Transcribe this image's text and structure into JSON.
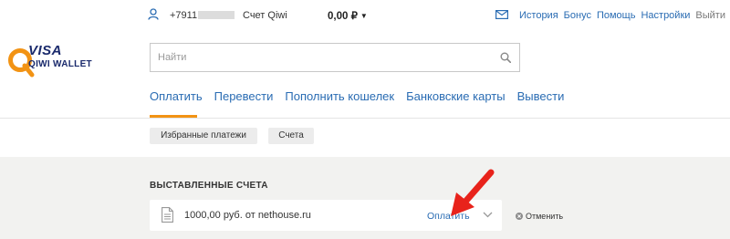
{
  "header": {
    "phone_prefix": "+7911",
    "account_label": "Счет Qiwi",
    "balance": "0,00 ₽",
    "balance_caret": "▼",
    "links": [
      "История",
      "Бонус",
      "Помощь",
      "Настройки"
    ],
    "logout": "Выйти"
  },
  "logo": {
    "visa": "VISA",
    "qiwi_wallet": "QIWI WALLET"
  },
  "search": {
    "placeholder": "Найти",
    "value": ""
  },
  "main_nav": {
    "items": [
      "Оплатить",
      "Перевести",
      "Пополнить кошелек",
      "Банковские карты",
      "Вывести"
    ],
    "active": "Оплатить"
  },
  "sub_tabs": [
    "Избранные платежи",
    "Счета"
  ],
  "bills": {
    "title": "ВЫСТАВЛЕННЫЕ СЧЕТА",
    "row": {
      "text": "1000,00 руб. от nethouse.ru",
      "pay_label": "Оплатить",
      "cancel_label": "Отменить"
    }
  },
  "colors": {
    "link": "#2a6cb3",
    "accent": "#f29314",
    "annotation_arrow": "#e8231b"
  }
}
